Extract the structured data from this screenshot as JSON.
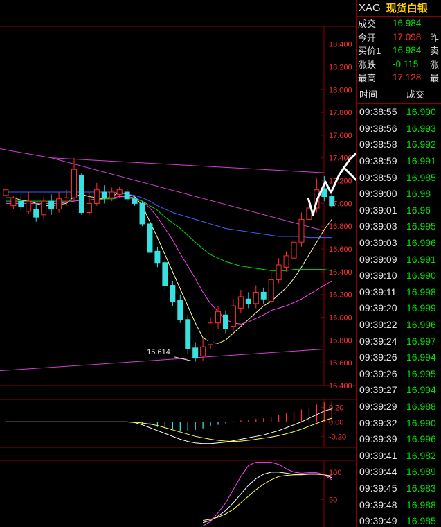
{
  "quote": {
    "code": "XAG",
    "name": "现货白银",
    "rows": [
      {
        "label": "成交",
        "value": "16.984",
        "color": "green",
        "extra": ""
      },
      {
        "label": "今开",
        "value": "17.098",
        "color": "red",
        "extra": "昨"
      },
      {
        "label": "买价1",
        "value": "16.984",
        "color": "green",
        "extra": "卖"
      },
      {
        "label": "涨跌",
        "value": "-0.115",
        "color": "green",
        "extra": "涨"
      },
      {
        "label": "最高",
        "value": "17.128",
        "color": "red",
        "extra": "最"
      }
    ]
  },
  "ticks": {
    "header_time": "时间",
    "header_price": "成交",
    "rows": [
      {
        "time": "09:38:55",
        "price": "16.990"
      },
      {
        "time": "09:38:56",
        "price": "16.993"
      },
      {
        "time": "09:38:58",
        "price": "16.992"
      },
      {
        "time": "09:38:59",
        "price": "16.991"
      },
      {
        "time": "09:38:59",
        "price": "16.985"
      },
      {
        "time": "09:39:00",
        "price": "16.98"
      },
      {
        "time": "09:39:01",
        "price": "16.96"
      },
      {
        "time": "09:39:03",
        "price": "16.995"
      },
      {
        "time": "09:39:03",
        "price": "16.996"
      },
      {
        "time": "09:39:09",
        "price": "16.991"
      },
      {
        "time": "09:39:10",
        "price": "16.990"
      },
      {
        "time": "09:39:11",
        "price": "16.998"
      },
      {
        "time": "09:39:20",
        "price": "16.999"
      },
      {
        "time": "09:39:22",
        "price": "16.996"
      },
      {
        "time": "09:39:24",
        "price": "16.997"
      },
      {
        "time": "09:39:26",
        "price": "16.994"
      },
      {
        "time": "09:39:26",
        "price": "16.995"
      },
      {
        "time": "09:39:27",
        "price": "16.994"
      },
      {
        "time": "09:39:29",
        "price": "16.988"
      },
      {
        "time": "09:39:32",
        "price": "16.990"
      },
      {
        "time": "09:39:39",
        "price": "16.996"
      },
      {
        "time": "09:39:41",
        "price": "16.982"
      },
      {
        "time": "09:39:44",
        "price": "16.989"
      },
      {
        "time": "09:39:45",
        "price": "16.983"
      },
      {
        "time": "09:39:48",
        "price": "16.988"
      },
      {
        "time": "09:39:49",
        "price": "16.985"
      }
    ]
  },
  "chart_data": [
    {
      "type": "candlestick",
      "title": "",
      "ylim": [
        15.4,
        18.55
      ],
      "y_ticks": [
        "18.400",
        "18.200",
        "18.000",
        "17.800",
        "17.600",
        "17.400",
        "17.200",
        "17.000",
        "16.800",
        "16.600",
        "16.400",
        "16.200",
        "16.000",
        "15.800",
        "15.600",
        "15.400"
      ],
      "y_tick_values": [
        18.4,
        18.2,
        18.0,
        17.8,
        17.6,
        17.4,
        17.2,
        17.0,
        16.8,
        16.6,
        16.4,
        16.2,
        16.0,
        15.8,
        15.6,
        15.4
      ],
      "low_annotation": "15.614",
      "low_annotation_value": 15.614,
      "candles": [
        {
          "o": 17.07,
          "c": 17.12,
          "h": 17.15,
          "l": 17.04
        },
        {
          "o": 16.98,
          "c": 17.05,
          "h": 17.07,
          "l": 16.95
        },
        {
          "o": 17.02,
          "c": 16.97,
          "h": 17.08,
          "l": 16.94
        },
        {
          "o": 16.93,
          "c": 17.02,
          "h": 17.1,
          "l": 16.91
        },
        {
          "o": 16.95,
          "c": 16.88,
          "h": 17.0,
          "l": 16.84
        },
        {
          "o": 16.9,
          "c": 17.02,
          "h": 17.06,
          "l": 16.86
        },
        {
          "o": 17.02,
          "c": 16.95,
          "h": 17.08,
          "l": 16.9
        },
        {
          "o": 16.95,
          "c": 17.04,
          "h": 17.1,
          "l": 16.92
        },
        {
          "o": 17.02,
          "c": 17.05,
          "h": 17.12,
          "l": 16.98
        },
        {
          "o": 17.05,
          "c": 17.3,
          "h": 17.4,
          "l": 17.02
        },
        {
          "o": 17.25,
          "c": 16.92,
          "h": 17.27,
          "l": 16.9
        },
        {
          "o": 16.92,
          "c": 17.0,
          "h": 17.1,
          "l": 16.9
        },
        {
          "o": 17.0,
          "c": 17.12,
          "h": 17.18,
          "l": 16.98
        },
        {
          "o": 17.1,
          "c": 17.05,
          "h": 17.16,
          "l": 17.0
        },
        {
          "o": 17.05,
          "c": 17.1,
          "h": 17.14,
          "l": 17.02
        },
        {
          "o": 17.08,
          "c": 17.12,
          "h": 17.15,
          "l": 17.05
        },
        {
          "o": 17.1,
          "c": 17.04,
          "h": 17.13,
          "l": 17.01
        },
        {
          "o": 17.04,
          "c": 17.0,
          "h": 17.07,
          "l": 16.98
        },
        {
          "o": 17.0,
          "c": 16.82,
          "h": 17.02,
          "l": 16.8
        },
        {
          "o": 16.82,
          "c": 16.57,
          "h": 16.85,
          "l": 16.52
        },
        {
          "o": 16.58,
          "c": 16.48,
          "h": 16.62,
          "l": 16.44
        },
        {
          "o": 16.48,
          "c": 16.28,
          "h": 16.5,
          "l": 16.24
        },
        {
          "o": 16.28,
          "c": 16.14,
          "h": 16.32,
          "l": 16.1
        },
        {
          "o": 16.15,
          "c": 15.98,
          "h": 16.2,
          "l": 15.95
        },
        {
          "o": 15.98,
          "c": 15.72,
          "h": 16.02,
          "l": 15.68
        },
        {
          "o": 15.73,
          "c": 15.64,
          "h": 15.78,
          "l": 15.61
        },
        {
          "o": 15.66,
          "c": 15.74,
          "h": 15.82,
          "l": 15.62
        },
        {
          "o": 15.76,
          "c": 15.95,
          "h": 16.0,
          "l": 15.72
        },
        {
          "o": 15.95,
          "c": 16.05,
          "h": 16.1,
          "l": 15.9
        },
        {
          "o": 16.02,
          "c": 15.9,
          "h": 16.06,
          "l": 15.86
        },
        {
          "o": 15.92,
          "c": 16.1,
          "h": 16.16,
          "l": 15.88
        },
        {
          "o": 16.08,
          "c": 16.18,
          "h": 16.24,
          "l": 16.04
        },
        {
          "o": 16.16,
          "c": 16.12,
          "h": 16.22,
          "l": 16.08
        },
        {
          "o": 16.12,
          "c": 16.22,
          "h": 16.28,
          "l": 16.08
        },
        {
          "o": 16.22,
          "c": 16.16,
          "h": 16.26,
          "l": 16.12
        },
        {
          "o": 16.14,
          "c": 16.33,
          "h": 16.4,
          "l": 16.12
        },
        {
          "o": 16.33,
          "c": 16.46,
          "h": 16.52,
          "l": 16.3
        },
        {
          "o": 16.44,
          "c": 16.54,
          "h": 16.58,
          "l": 16.4
        },
        {
          "o": 16.52,
          "c": 16.66,
          "h": 16.72,
          "l": 16.5
        },
        {
          "o": 16.66,
          "c": 16.86,
          "h": 16.92,
          "l": 16.62
        },
        {
          "o": 16.86,
          "c": 16.96,
          "h": 17.02,
          "l": 16.82
        },
        {
          "o": 16.96,
          "c": 17.12,
          "h": 17.22,
          "l": 16.92
        },
        {
          "o": 17.13,
          "c": 17.06,
          "h": 17.24,
          "l": 17.02
        },
        {
          "o": 17.06,
          "c": 16.98,
          "h": 17.1,
          "l": 16.96
        }
      ],
      "moving_averages": [
        {
          "color": "#ffffa0",
          "values": [
            17.05,
            17.05,
            17.03,
            17.02,
            17.0,
            16.98,
            16.98,
            16.99,
            17.0,
            17.06,
            17.08,
            17.06,
            17.05,
            17.04,
            17.06,
            17.1,
            17.08,
            17.06,
            16.98,
            16.84,
            16.7,
            16.55,
            16.4,
            16.25,
            16.1,
            15.95,
            15.82,
            15.78,
            15.77,
            15.8,
            15.86,
            15.92,
            15.98,
            16.04,
            16.1,
            16.14,
            16.2,
            16.26,
            16.34,
            16.44,
            16.55,
            16.66,
            16.77,
            16.86
          ]
        },
        {
          "color": "#ff40ff",
          "values": [
            17.0,
            17.0,
            17.0,
            17.0,
            17.0,
            17.0,
            17.0,
            17.0,
            17.01,
            17.02,
            17.03,
            17.03,
            17.04,
            17.04,
            17.05,
            17.06,
            17.06,
            17.05,
            17.02,
            16.96,
            16.88,
            16.78,
            16.68,
            16.56,
            16.45,
            16.34,
            16.22,
            16.12,
            16.05,
            15.98,
            15.95,
            15.94,
            15.96,
            15.99,
            16.02,
            16.06,
            16.08,
            16.1,
            16.13,
            16.16,
            16.2,
            16.24,
            16.28,
            16.32
          ]
        },
        {
          "color": "#00e000",
          "values": [
            17.02,
            17.02,
            17.02,
            17.02,
            17.02,
            17.02,
            17.02,
            17.02,
            17.02,
            17.03,
            17.03,
            17.03,
            17.03,
            17.04,
            17.04,
            17.05,
            17.05,
            17.04,
            17.02,
            16.98,
            16.94,
            16.88,
            16.83,
            16.78,
            16.72,
            16.66,
            16.6,
            16.55,
            16.52,
            16.49,
            16.47,
            16.45,
            16.44,
            16.43,
            16.42,
            16.41,
            16.41,
            16.41,
            16.42,
            16.42,
            16.42,
            16.42,
            16.42,
            16.41
          ]
        },
        {
          "color": "#4060ff",
          "values": [
            17.1,
            17.1,
            17.1,
            17.1,
            17.1,
            17.1,
            17.1,
            17.1,
            17.1,
            17.1,
            17.1,
            17.1,
            17.1,
            17.1,
            17.1,
            17.09,
            17.08,
            17.07,
            17.05,
            17.02,
            16.98,
            16.95,
            16.92,
            16.9,
            16.88,
            16.86,
            16.84,
            16.82,
            16.8,
            16.78,
            16.77,
            16.76,
            16.75,
            16.74,
            16.73,
            16.72,
            16.71,
            16.71,
            16.71,
            16.71,
            16.7,
            16.7,
            16.7,
            16.7
          ]
        }
      ]
    },
    {
      "type": "macd",
      "title": "",
      "ylim": [
        -0.35,
        0.3
      ],
      "y_ticks": [
        "0.20",
        "0.00",
        "-0.20"
      ],
      "y_tick_values": [
        0.2,
        0.0,
        -0.2
      ],
      "bars": [
        0,
        0,
        0,
        0,
        0,
        0,
        0,
        0,
        0,
        0,
        0,
        0,
        0,
        0,
        0,
        0,
        0,
        -0.01,
        -0.03,
        -0.05,
        -0.07,
        -0.09,
        -0.1,
        -0.12,
        -0.12,
        -0.11,
        -0.09,
        -0.06,
        -0.04,
        -0.02,
        0.01,
        0.02,
        0.03,
        0.04,
        0.05,
        0.07,
        0.09,
        0.12,
        0.14,
        0.17,
        0.2,
        0.24,
        0.27,
        0.28
      ],
      "dif": [
        0,
        0,
        0,
        0,
        0,
        0,
        0,
        0,
        0,
        0,
        0,
        0,
        0,
        0,
        0,
        0,
        0,
        -0.01,
        -0.04,
        -0.08,
        -0.12,
        -0.16,
        -0.2,
        -0.24,
        -0.27,
        -0.29,
        -0.3,
        -0.3,
        -0.29,
        -0.28,
        -0.26,
        -0.24,
        -0.22,
        -0.2,
        -0.18,
        -0.15,
        -0.12,
        -0.08,
        -0.04,
        0.0,
        0.05,
        0.1,
        0.15,
        0.18
      ],
      "dea": [
        0,
        0,
        0,
        0,
        0,
        0,
        0,
        0,
        0,
        0,
        0,
        0,
        0,
        0,
        0,
        0,
        0,
        -0.005,
        -0.015,
        -0.03,
        -0.05,
        -0.08,
        -0.11,
        -0.14,
        -0.17,
        -0.2,
        -0.22,
        -0.24,
        -0.255,
        -0.265,
        -0.27,
        -0.265,
        -0.255,
        -0.24,
        -0.225,
        -0.21,
        -0.19,
        -0.165,
        -0.135,
        -0.1,
        -0.06,
        -0.02,
        0.02,
        0.05
      ]
    },
    {
      "type": "kdj",
      "title": "",
      "ylim": [
        0,
        120
      ],
      "y_ticks": [
        "100",
        "50"
      ],
      "y_tick_values": [
        100,
        50
      ],
      "k": [
        null,
        null,
        null,
        null,
        null,
        null,
        null,
        null,
        null,
        null,
        null,
        null,
        null,
        null,
        null,
        null,
        null,
        null,
        null,
        null,
        null,
        null,
        null,
        null,
        null,
        null,
        8,
        12,
        20,
        30,
        44,
        60,
        76,
        88,
        96,
        100,
        100,
        98,
        96,
        96,
        97,
        97,
        95,
        90
      ],
      "d": [
        null,
        null,
        null,
        null,
        null,
        null,
        null,
        null,
        null,
        null,
        null,
        null,
        null,
        null,
        null,
        null,
        null,
        null,
        null,
        null,
        null,
        null,
        null,
        null,
        null,
        null,
        12,
        14,
        18,
        24,
        32,
        44,
        56,
        68,
        78,
        86,
        92,
        94,
        95,
        95,
        96,
        96,
        95,
        93
      ],
      "j": [
        null,
        null,
        null,
        null,
        null,
        null,
        null,
        null,
        null,
        null,
        null,
        null,
        null,
        null,
        null,
        null,
        null,
        null,
        null,
        null,
        null,
        null,
        null,
        null,
        null,
        null,
        2,
        10,
        26,
        44,
        68,
        92,
        112,
        118,
        118,
        118,
        114,
        106,
        100,
        98,
        99,
        99,
        95,
        86
      ]
    }
  ],
  "colors": {
    "up": "#ff3030",
    "down": "#38e0e0",
    "grid": "#8b0000",
    "axis_text": "#ff3030",
    "trend": "#d040d0"
  }
}
